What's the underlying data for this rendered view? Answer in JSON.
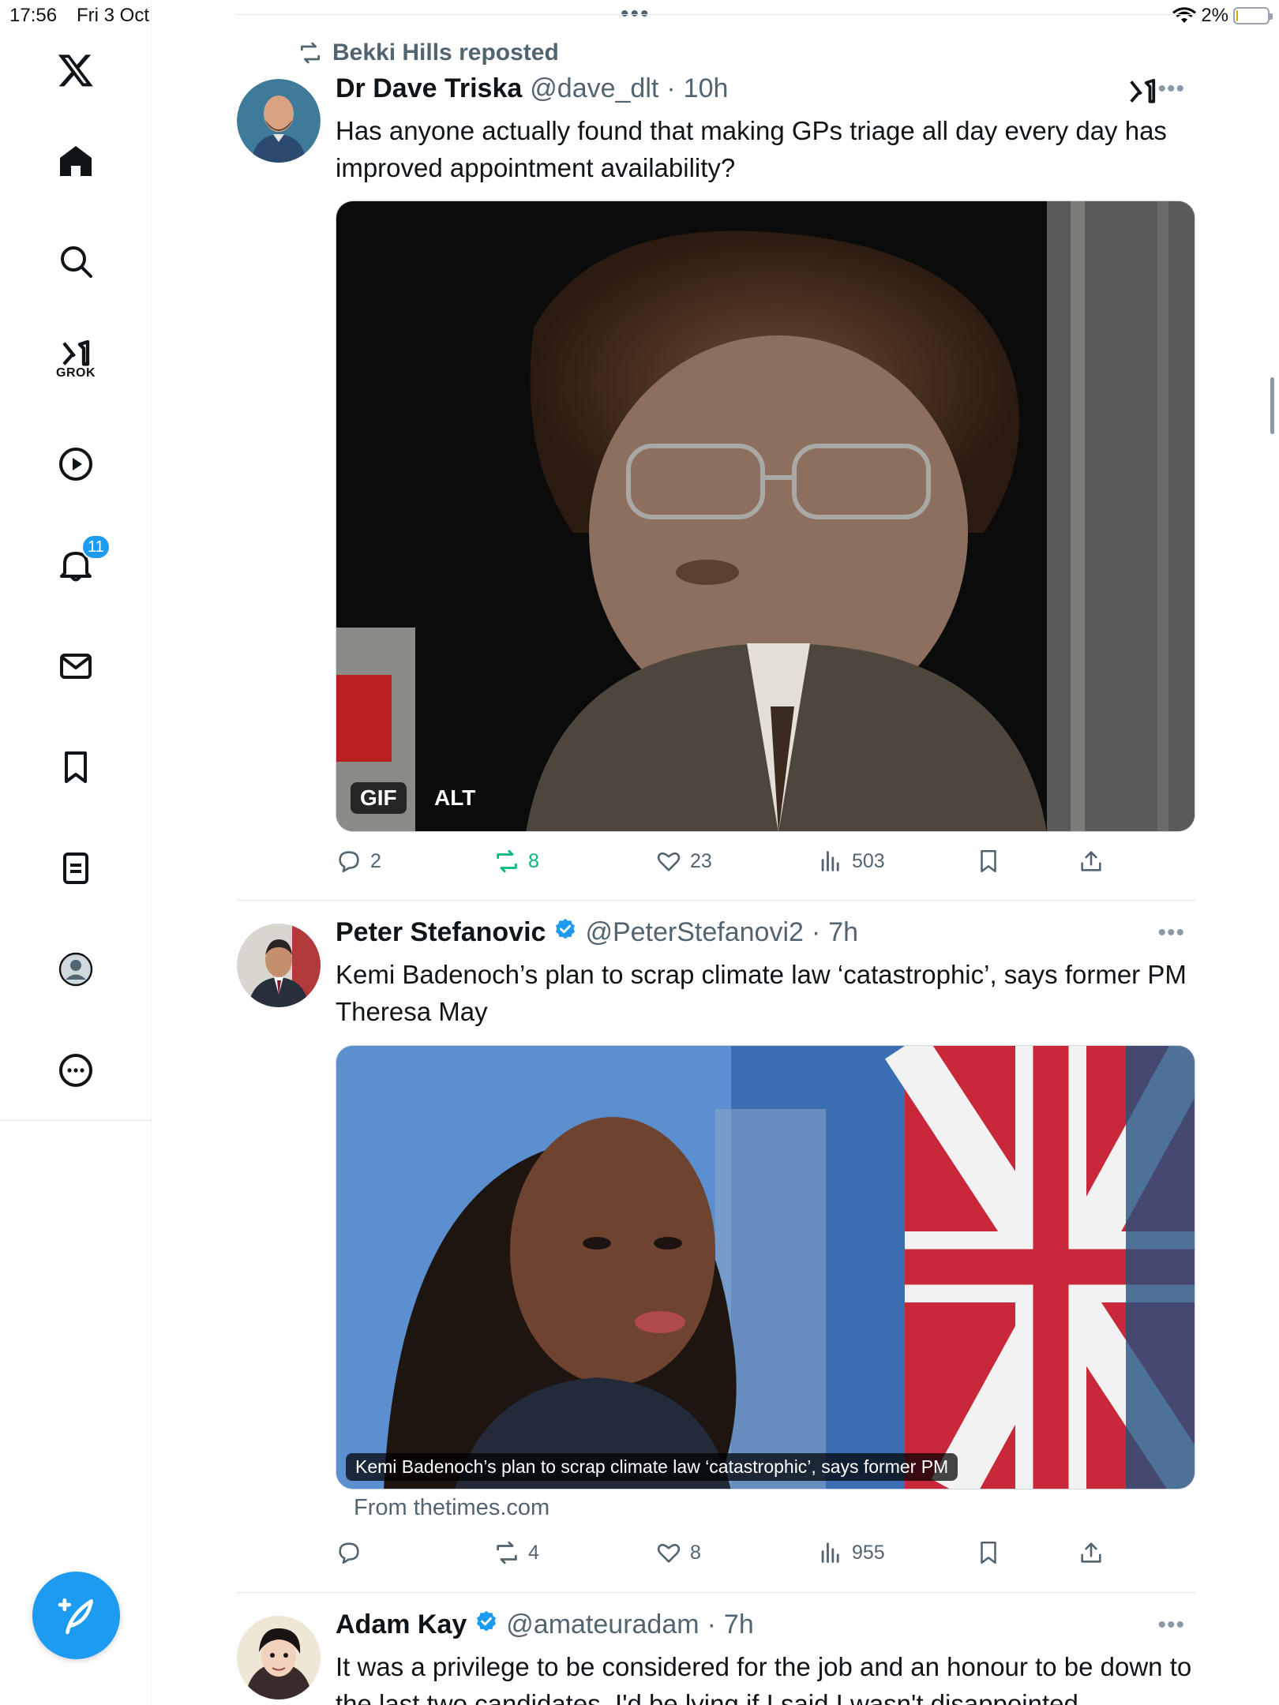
{
  "status_bar": {
    "time": "17:56",
    "date": "Fri 3 Oct",
    "battery": "2%"
  },
  "sidebar": {
    "items": [
      {
        "name": "x-logo"
      },
      {
        "name": "home"
      },
      {
        "name": "explore"
      },
      {
        "name": "grok",
        "label": "GROK"
      },
      {
        "name": "videos"
      },
      {
        "name": "notifications",
        "badge": "11"
      },
      {
        "name": "messages"
      },
      {
        "name": "bookmarks"
      },
      {
        "name": "lists"
      },
      {
        "name": "profile"
      },
      {
        "name": "more"
      }
    ],
    "compose": "compose-icon"
  },
  "tweets": [
    {
      "repost_label": "Bekki Hills reposted",
      "name": "Dr Dave Triska",
      "handle": "@dave_dlt",
      "sep": "·",
      "time": "10h",
      "text": "Has anyone actually found that making GPs triage all day every day has improved appointment availability?",
      "media": {
        "gif": "GIF",
        "alt": "ALT"
      },
      "replies": "2",
      "reposts": "8",
      "likes": "23",
      "views": "503"
    },
    {
      "name": "Peter Stefanovic",
      "handle": "@PeterStefanovi2",
      "sep": "·",
      "time": "7h",
      "text": "Kemi Badenoch’s plan to scrap climate law ‘catastrophic’, says former PM Theresa May",
      "media": {
        "caption": "Kemi Badenoch’s plan to scrap climate law ‘catastrophic’, says former PM"
      },
      "source": "From thetimes.com",
      "replies": "",
      "reposts": "4",
      "likes": "8",
      "views": "955"
    },
    {
      "name": "Adam Kay",
      "handle": "@amateuradam",
      "sep": "·",
      "time": "7h",
      "text": "It was a privilege to be considered for the job and an honour to be down to the last two candidates. I'd be lying if I said I wasn't disappointed"
    }
  ],
  "colors": {
    "accent": "#1d9bf0",
    "repost_active": "#00ba7c",
    "muted": "#536471"
  }
}
